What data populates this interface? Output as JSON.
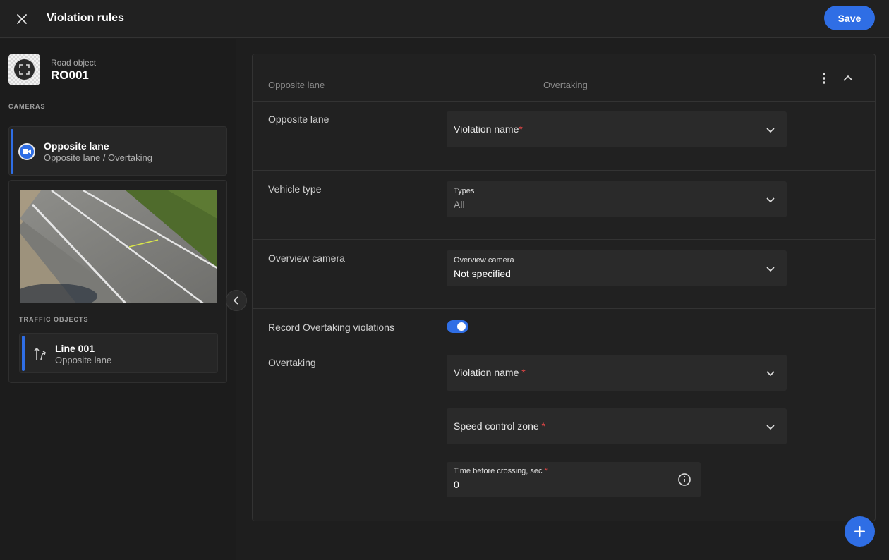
{
  "header": {
    "title": "Violation rules",
    "save_label": "Save"
  },
  "road_object": {
    "label": "Road object",
    "id": "RO001"
  },
  "cameras": {
    "section_title": "CAMERAS",
    "items": [
      {
        "name": "Opposite lane",
        "sub": "Opposite lane / Overtaking"
      }
    ]
  },
  "traffic_objects": {
    "section_title": "TRAFFIC OBJECTS",
    "items": [
      {
        "name": "Line 001",
        "sub": "Opposite lane"
      }
    ]
  },
  "panel": {
    "columns": [
      {
        "dash": "—",
        "label": "Opposite lane"
      },
      {
        "dash": "—",
        "label": "Overtaking"
      }
    ],
    "opposite_lane": {
      "label": "Opposite lane",
      "violation_name": "Violation name",
      "required_mark": "*"
    },
    "vehicle_type": {
      "label": "Vehicle type",
      "field_label": "Types",
      "value": "All"
    },
    "overview_camera": {
      "label": "Overview camera",
      "field_label": "Overview camera",
      "value": "Not specified"
    },
    "record": {
      "label": "Record Overtaking violations",
      "enabled": true
    },
    "overtaking": {
      "label": "Overtaking",
      "violation_name": "Violation name ",
      "speed_zone": "Speed control zone ",
      "time_label": "Time before crossing, sec ",
      "time_value": "0",
      "required_mark": "*"
    }
  },
  "colors": {
    "accent": "#2f6ee5",
    "required": "#e04545",
    "background": "#1e1e1e"
  }
}
